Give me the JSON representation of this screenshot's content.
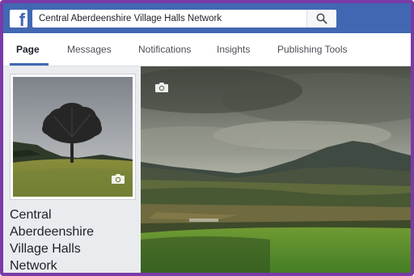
{
  "header": {
    "search": {
      "value": "Central Aberdeenshire Village Halls Network"
    },
    "icons": {
      "logo": "facebook-f-icon",
      "search": "search-icon"
    }
  },
  "tabs": [
    {
      "label": "Page",
      "active": true
    },
    {
      "label": "Messages",
      "active": false
    },
    {
      "label": "Notifications",
      "active": false
    },
    {
      "label": "Insights",
      "active": false
    },
    {
      "label": "Publishing Tools",
      "active": false
    }
  ],
  "profile": {
    "name_lines": [
      "Central",
      "Aberdeenshire",
      "Village Halls",
      "Network"
    ],
    "photo_icon": "camera-icon"
  },
  "cover": {
    "photo_icon": "camera-icon"
  },
  "colors": {
    "brand": "#4267b2",
    "frame": "#7a3aa8",
    "background": "#e9ebee"
  }
}
